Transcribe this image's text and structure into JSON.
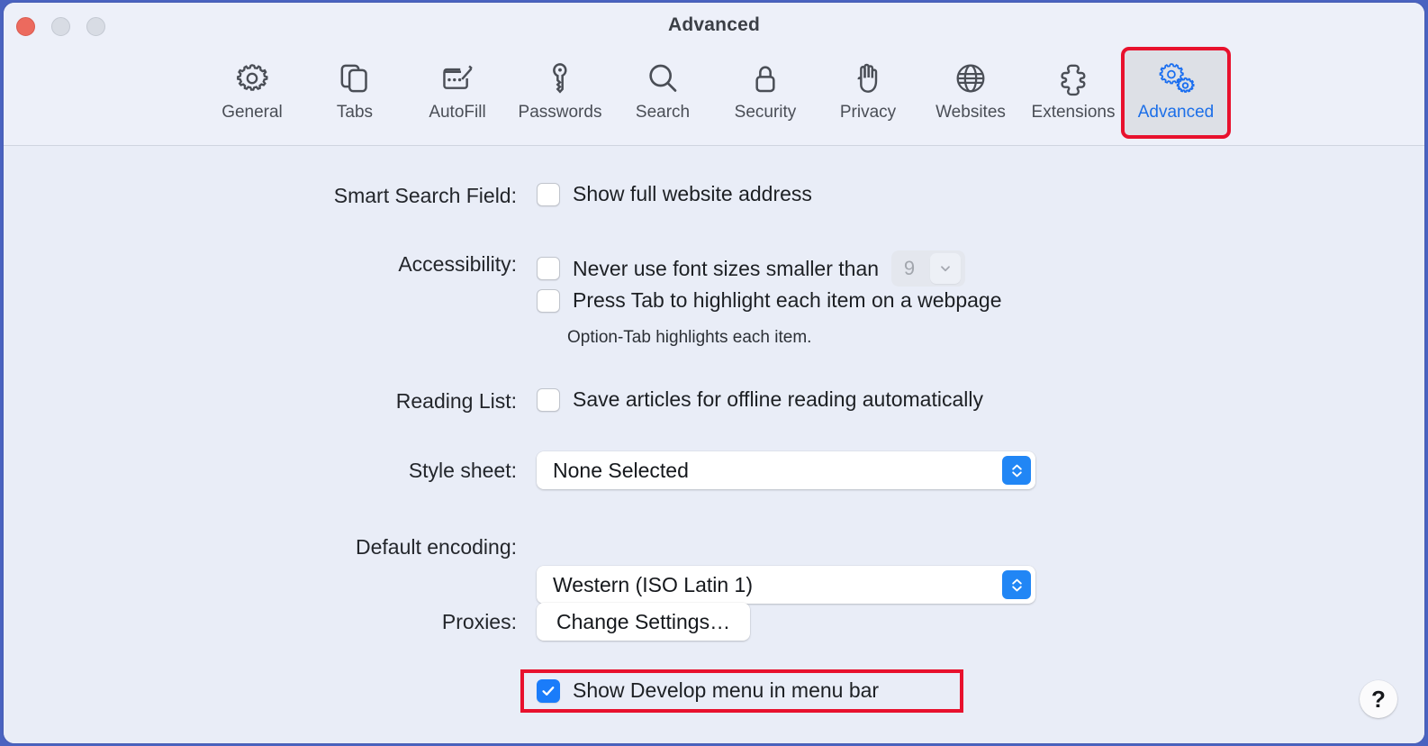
{
  "window": {
    "title": "Advanced",
    "traffic_lights": [
      {
        "name": "close",
        "color": "#ec6a5e"
      },
      {
        "name": "minimize",
        "color": "#d8dce4"
      },
      {
        "name": "maximize",
        "color": "#d8dce4"
      }
    ]
  },
  "toolbar": {
    "items": [
      {
        "label": "General",
        "icon": "gear-icon",
        "selected": false,
        "highlighted": false
      },
      {
        "label": "Tabs",
        "icon": "tabs-icon",
        "selected": false,
        "highlighted": false
      },
      {
        "label": "AutoFill",
        "icon": "autofill-icon",
        "selected": false,
        "highlighted": false
      },
      {
        "label": "Passwords",
        "icon": "key-icon",
        "selected": false,
        "highlighted": false
      },
      {
        "label": "Search",
        "icon": "magnifier-icon",
        "selected": false,
        "highlighted": false
      },
      {
        "label": "Security",
        "icon": "lock-icon",
        "selected": false,
        "highlighted": false
      },
      {
        "label": "Privacy",
        "icon": "hand-icon",
        "selected": false,
        "highlighted": false
      },
      {
        "label": "Websites",
        "icon": "globe-icon",
        "selected": false,
        "highlighted": false
      },
      {
        "label": "Extensions",
        "icon": "puzzle-icon",
        "selected": false,
        "highlighted": false
      },
      {
        "label": "Advanced",
        "icon": "two-gears-icon",
        "selected": true,
        "highlighted": true
      }
    ],
    "selected_color": "#1c6fe8",
    "highlight_color": "#e8112d"
  },
  "settings": {
    "smart_search_field": {
      "label": "Smart Search Field:",
      "checkbox_label": "Show full website address",
      "checked": false
    },
    "accessibility": {
      "label": "Accessibility:",
      "min_font": {
        "checkbox_label": "Never use font sizes smaller than",
        "checked": false,
        "value": "9",
        "disabled": true
      },
      "press_tab": {
        "checkbox_label": "Press Tab to highlight each item on a webpage",
        "checked": false
      },
      "hint": "Option-Tab highlights each item."
    },
    "reading_list": {
      "label": "Reading List:",
      "checkbox_label": "Save articles for offline reading automatically",
      "checked": false
    },
    "style_sheet": {
      "label": "Style sheet:",
      "value": "None Selected"
    },
    "default_encoding": {
      "label": "Default encoding:",
      "value": "Western (ISO Latin 1)"
    },
    "proxies": {
      "label": "Proxies:",
      "button_label": "Change Settings…"
    },
    "develop_menu": {
      "checkbox_label": "Show Develop menu in menu bar",
      "checked": true,
      "highlighted": true
    }
  },
  "help": {
    "label": "?"
  }
}
